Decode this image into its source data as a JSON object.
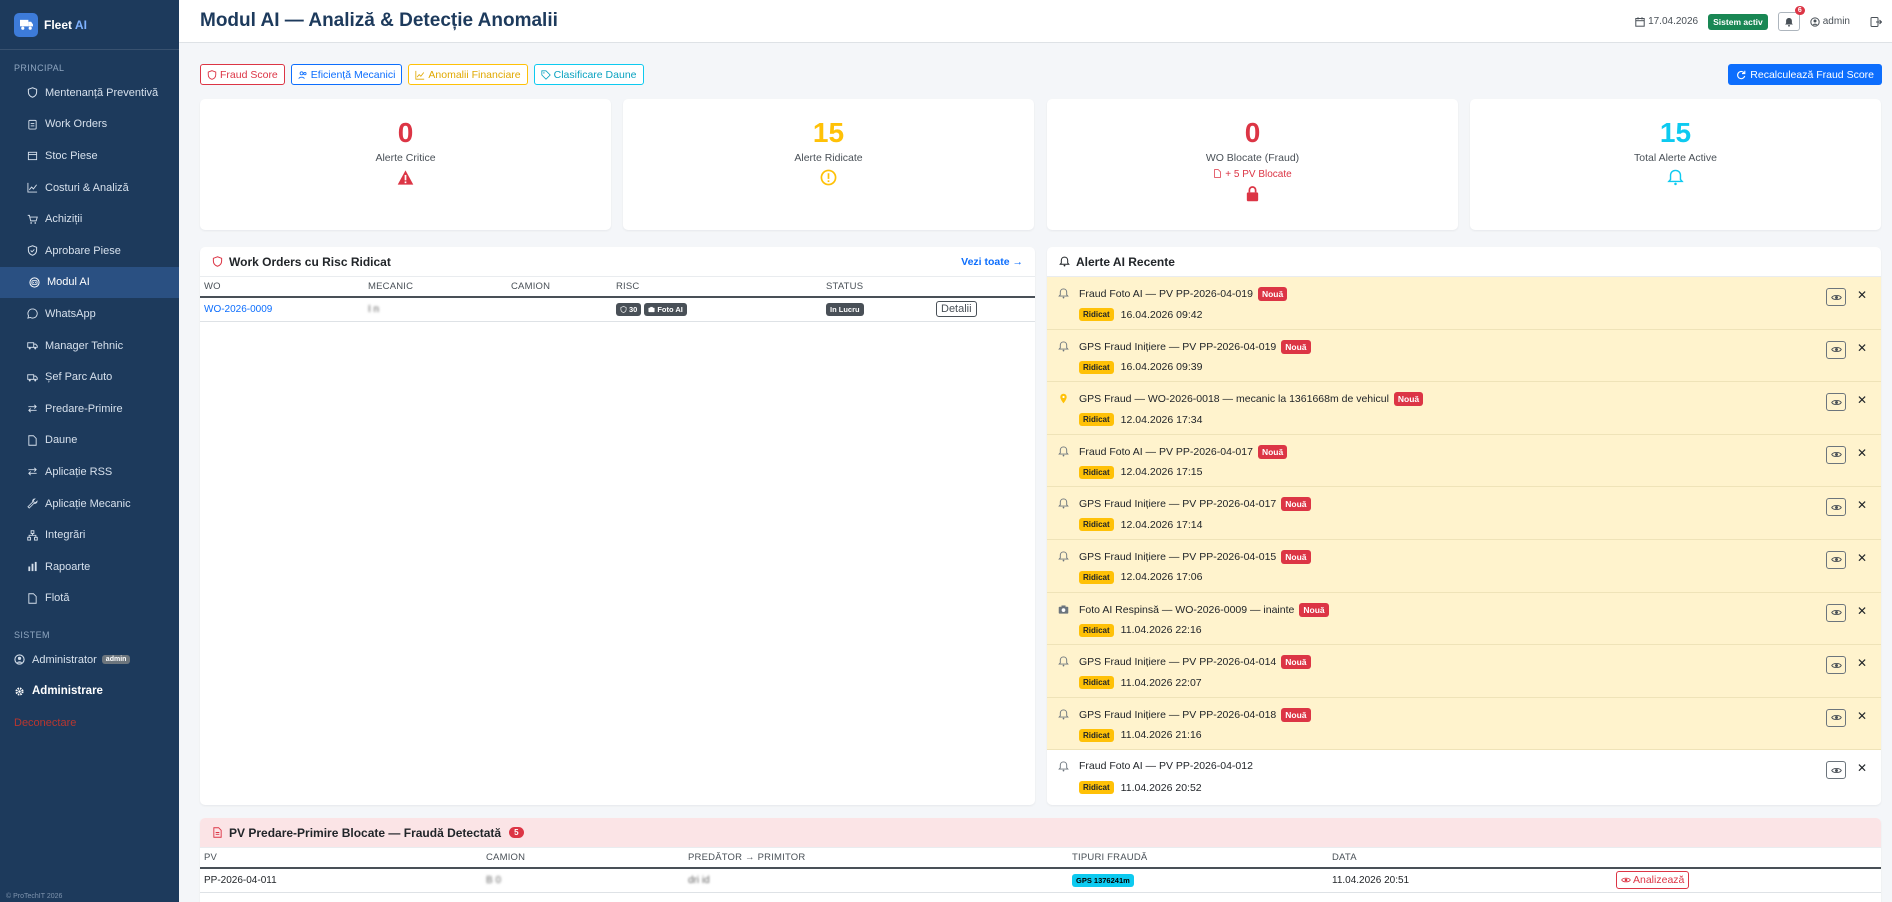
{
  "brand": {
    "name": "Fleet",
    "accent": "AI"
  },
  "sidebar": {
    "section_main": "PRINCIPAL",
    "items": [
      {
        "label": "Mentenanță Preventivă",
        "icon": "shield-icon"
      },
      {
        "label": "Work Orders",
        "icon": "clipboard-icon"
      },
      {
        "label": "Stoc Piese",
        "icon": "box-icon"
      },
      {
        "label": "Costuri & Analiză",
        "icon": "chart-line-icon"
      },
      {
        "label": "Achiziții",
        "icon": "cart-icon"
      },
      {
        "label": "Aprobare Piese",
        "icon": "shield-check-icon"
      },
      {
        "label": "Modul AI",
        "icon": "robot-icon",
        "active": true
      },
      {
        "label": "WhatsApp",
        "icon": "whatsapp-icon"
      },
      {
        "label": "Manager Tehnic",
        "icon": "truck-icon"
      },
      {
        "label": "Șef Parc Auto",
        "icon": "truck-icon"
      },
      {
        "label": "Predare-Primire",
        "icon": "swap-icon"
      },
      {
        "label": "Daune",
        "icon": "file-icon"
      },
      {
        "label": "Aplicație RSS",
        "icon": "swap-icon"
      },
      {
        "label": "Aplicație Mecanic",
        "icon": "wrench-icon"
      },
      {
        "label": "Integrări",
        "icon": "diagram-icon"
      },
      {
        "label": "Rapoarte",
        "icon": "bar-chart-icon"
      },
      {
        "label": "Flotă",
        "icon": "file-icon"
      }
    ],
    "section_system": "SISTEM",
    "admin_user": "Administrator",
    "admin_badge": "admin",
    "admin_menu": "Administrare",
    "logout": "Deconectare",
    "footer": "© ProTechIT 2026"
  },
  "header": {
    "title": "Modul AI — Analiză & Detecție Anomalii",
    "date": "17.04.2026",
    "status": "Sistem activ",
    "notif_count": "6",
    "user": "admin"
  },
  "tabs": [
    {
      "label": "Fraud Score",
      "style": "red",
      "icon": "shield-icon"
    },
    {
      "label": "Eficiență Mecanici",
      "style": "blue",
      "icon": "users-icon"
    },
    {
      "label": "Anomalii Financiare",
      "style": "yellow",
      "icon": "chart-line-icon"
    },
    {
      "label": "Clasificare Daune",
      "style": "cyan",
      "icon": "tag-icon"
    }
  ],
  "recalc_button": "Recalculează Fraud Score",
  "stats": [
    {
      "value": "0",
      "label": "Alerte Critice",
      "color": "#dc3545",
      "icon": "warning-triangle-icon"
    },
    {
      "value": "15",
      "label": "Alerte Ridicate",
      "color": "#ffc107",
      "icon": "exclamation-circle-icon"
    },
    {
      "value": "0",
      "label": "WO Blocate (Fraud)",
      "sub": "+ 5 PV Blocate",
      "color": "#dc3545",
      "icon": "lock-icon"
    },
    {
      "value": "15",
      "label": "Total Alerte Active",
      "color": "#0dcaf0",
      "icon": "bell-icon"
    }
  ],
  "work_orders": {
    "title": "Work Orders cu Risc Ridicat",
    "see_all": "Vezi toate →",
    "columns": [
      "WO",
      "MECANIC",
      "CAMION",
      "RISC",
      "STATUS",
      ""
    ],
    "rows": [
      {
        "wo": "WO-2026-0009",
        "mecanic": "I        n",
        "camion": "",
        "risk_score": "30",
        "risk_tag": "Foto AI",
        "status": "In Lucru",
        "action": "Detalii"
      }
    ]
  },
  "alerts": {
    "title": "Alerte AI Recente",
    "new_label": "Nouă",
    "level_label": "Ridicat",
    "items": [
      {
        "icon": "bell-icon",
        "title": "Fraud Foto AI — PV PP-2026-04-019",
        "time": "16.04.2026 09:42",
        "new": true
      },
      {
        "icon": "bell-icon",
        "title": "GPS Fraud Inițiere — PV PP-2026-04-019",
        "time": "16.04.2026 09:39",
        "new": true
      },
      {
        "icon": "map-pin-icon",
        "title": "GPS Fraud — WO-2026-0018 — mecanic la 1361668m de vehicul",
        "time": "12.04.2026 17:34",
        "new": true
      },
      {
        "icon": "bell-icon",
        "title": "Fraud Foto AI — PV PP-2026-04-017",
        "time": "12.04.2026 17:15",
        "new": true
      },
      {
        "icon": "bell-icon",
        "title": "GPS Fraud Inițiere — PV PP-2026-04-017",
        "time": "12.04.2026 17:14",
        "new": true
      },
      {
        "icon": "bell-icon",
        "title": "GPS Fraud Inițiere — PV PP-2026-04-015",
        "time": "12.04.2026 17:06",
        "new": true
      },
      {
        "icon": "camera-icon",
        "title": "Foto AI Respinsă — WO-2026-0009 — inainte",
        "time": "11.04.2026 22:16",
        "new": true
      },
      {
        "icon": "bell-icon",
        "title": "GPS Fraud Inițiere — PV PP-2026-04-014",
        "time": "11.04.2026 22:07",
        "new": true
      },
      {
        "icon": "bell-icon",
        "title": "GPS Fraud Inițiere — PV PP-2026-04-018",
        "time": "11.04.2026 21:16",
        "new": true
      },
      {
        "icon": "bell-icon",
        "title": "Fraud Foto AI — PV PP-2026-04-012",
        "time": "11.04.2026 20:52",
        "new": false
      }
    ]
  },
  "pv_blocked": {
    "title": "PV Predare-Primire Blocate — Fraudă Detectată",
    "count": "5",
    "columns": [
      "PV",
      "CAMION",
      "PREDĂTOR → PRIMITOR",
      "TIPURI FRAUDĂ",
      "DATA",
      ""
    ],
    "rows": [
      {
        "pv": "PP-2026-04-011",
        "camion": "B       0",
        "parties": "dri        id",
        "fraud": "GPS 1376241m",
        "date": "11.04.2026 20:51",
        "action": "Analizează"
      }
    ]
  }
}
